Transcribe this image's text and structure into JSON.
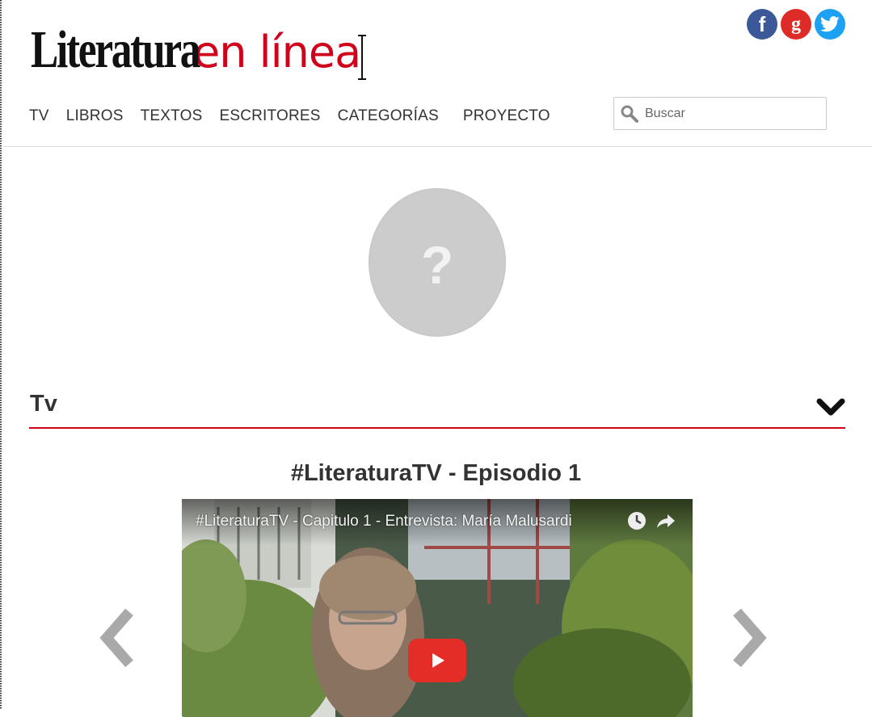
{
  "header": {
    "logo_part1": "Literatura",
    "logo_part2": "en línea",
    "social": [
      {
        "name": "facebook",
        "glyph": "f",
        "color": "#3b5998"
      },
      {
        "name": "google-plus",
        "glyph": "g",
        "color": "#dd2c27"
      },
      {
        "name": "twitter",
        "glyph": "",
        "color": "#1da1f2"
      }
    ]
  },
  "nav": {
    "items": [
      "TV",
      "LIBROS",
      "TEXTOS",
      "ESCRITORES",
      "CATEGORÍAS",
      "PROYECTO"
    ]
  },
  "search": {
    "placeholder": "Buscar",
    "value": ""
  },
  "profile": {
    "avatar_placeholder": "?"
  },
  "section": {
    "title": "Tv",
    "accent_color": "#d0021b"
  },
  "episode": {
    "title": "#LiteraturaTV - Episodio 1",
    "video_title": "#LiteraturaTV - Capitulo 1 - Entrevista: María Malusardi"
  },
  "icons": {
    "watch_later": "clock-icon",
    "share": "share-arrow-icon",
    "play": "play-icon",
    "prev": "chevron-left-icon",
    "next": "chevron-right-icon",
    "toggle": "chevron-down-icon",
    "search": "magnifier-icon"
  }
}
